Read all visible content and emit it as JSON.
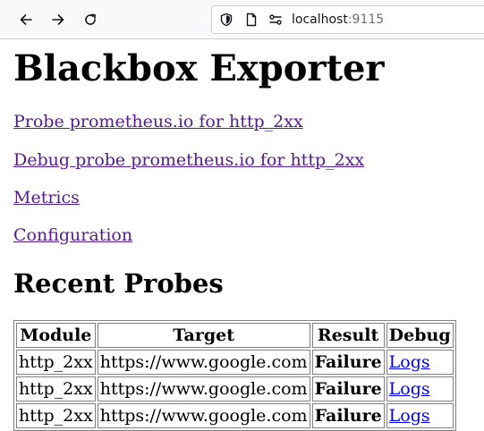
{
  "browser": {
    "back_icon": "arrow-left-icon",
    "forward_icon": "arrow-right-icon",
    "reload_icon": "reload-icon",
    "shield_icon": "shield-icon",
    "page_icon": "page-icon",
    "connection_icon": "connection-icon",
    "url_host": "localhost",
    "url_port": ":9115"
  },
  "page": {
    "title": "Blackbox Exporter",
    "links": [
      "Probe prometheus.io for http_2xx",
      "Debug probe prometheus.io for http_2xx",
      "Metrics",
      "Configuration"
    ],
    "recent_title": "Recent Probes",
    "table": {
      "headers": [
        "Module",
        "Target",
        "Result",
        "Debug"
      ],
      "rows": [
        {
          "module": "http_2xx",
          "target": "https://www.google.com",
          "result": "Failure",
          "debug": "Logs"
        },
        {
          "module": "http_2xx",
          "target": "https://www.google.com",
          "result": "Failure",
          "debug": "Logs"
        },
        {
          "module": "http_2xx",
          "target": "https://www.google.com",
          "result": "Failure",
          "debug": "Logs"
        }
      ]
    }
  },
  "colors": {
    "visited_link": "#551a8b",
    "link": "#0000ee",
    "toolbar_bg": "#f9f9fb"
  }
}
